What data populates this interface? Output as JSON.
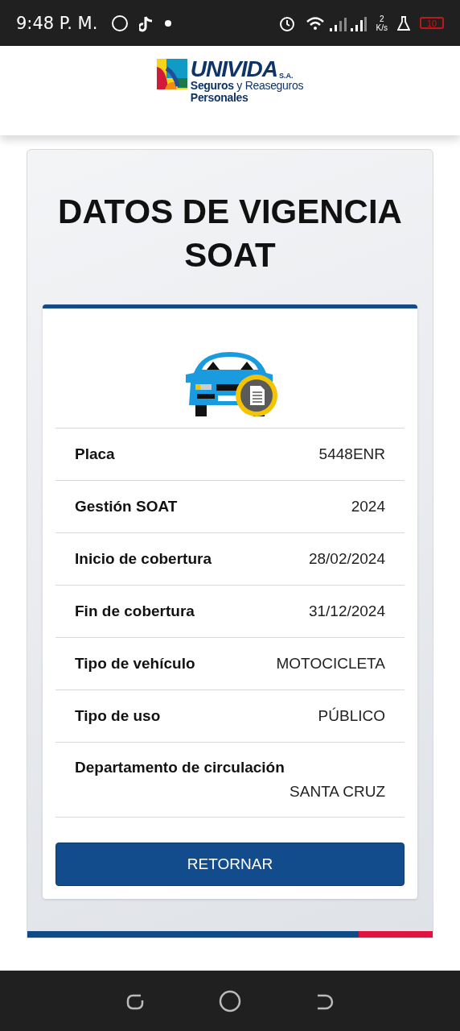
{
  "status_bar": {
    "time": "9:48 P. M.",
    "speed_value": "2",
    "speed_unit": "K/s",
    "battery": "10"
  },
  "logo": {
    "name": "UNIVIDA",
    "suffix": "S.A.",
    "line_1": "**Seguros** y Reaseguros",
    "line_2": "Personales"
  },
  "title": "DATOS DE VIGENCIA SOAT",
  "rows": [
    {
      "kind": "inline",
      "label": "Placa",
      "value": "5448ENR"
    },
    {
      "kind": "inline",
      "label": "Gestión SOAT",
      "value": "2024"
    },
    {
      "kind": "inline",
      "label": "Inicio de cobertura",
      "value": "28/02/2024"
    },
    {
      "kind": "inline",
      "label": "Fin de cobertura",
      "value": "31/12/2024"
    },
    {
      "kind": "inline",
      "label": "Tipo de vehículo",
      "value": "MOTOCICLETA"
    },
    {
      "kind": "inline",
      "label": "Tipo de uso",
      "value": "PÚBLICO"
    },
    {
      "kind": "stacked",
      "label": "Departamento de circulación",
      "value": "SANTA CRUZ"
    }
  ],
  "button": "RETORNAR"
}
